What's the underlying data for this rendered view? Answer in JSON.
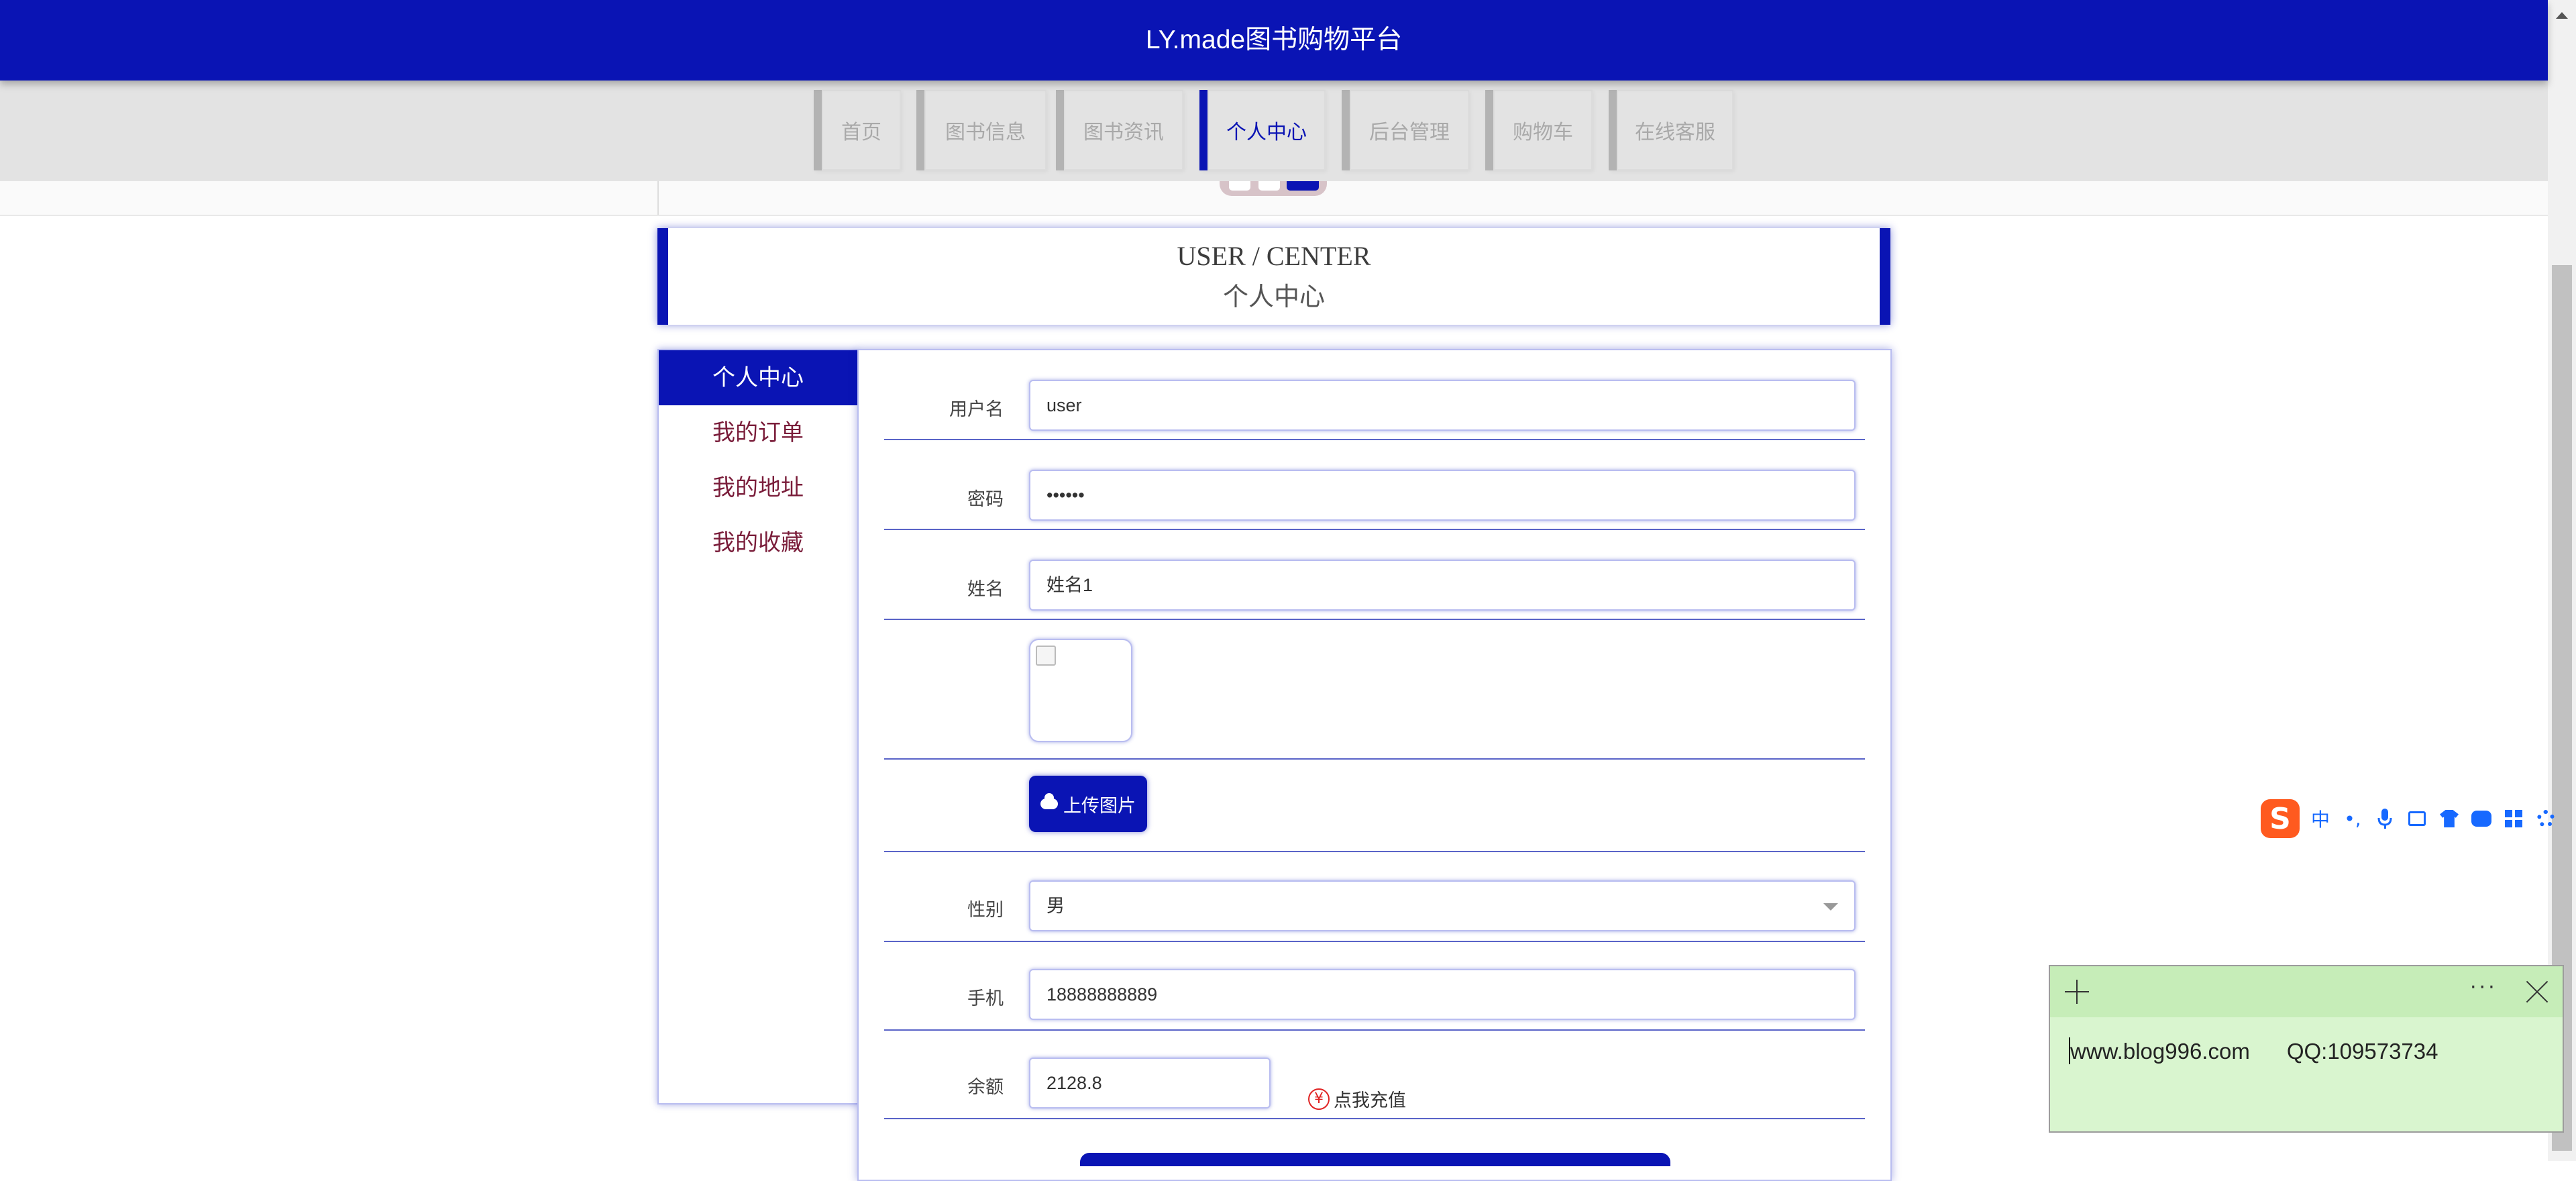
{
  "header": {
    "brand": "LY.made图书购物平台"
  },
  "nav": {
    "tabs": [
      {
        "label": "首页",
        "active": false
      },
      {
        "label": "图书信息",
        "active": false
      },
      {
        "label": "图书资讯",
        "active": false
      },
      {
        "label": "个人中心",
        "active": true
      },
      {
        "label": "后台管理",
        "active": false
      },
      {
        "label": "购物车",
        "active": false
      },
      {
        "label": "在线客服",
        "active": false
      }
    ]
  },
  "title_card": {
    "en": "USER / CENTER",
    "cn": "个人中心"
  },
  "sidemenu": {
    "items": [
      {
        "label": "个人中心",
        "active": true
      },
      {
        "label": "我的订单",
        "active": false
      },
      {
        "label": "我的地址",
        "active": false
      },
      {
        "label": "我的收藏",
        "active": false
      }
    ]
  },
  "form": {
    "username": {
      "label": "用户名",
      "value": "user"
    },
    "password": {
      "label": "密码",
      "value": "••••••"
    },
    "name": {
      "label": "姓名",
      "value": "姓名1"
    },
    "upload_button": "上传图片",
    "gender": {
      "label": "性别",
      "value": "男"
    },
    "phone": {
      "label": "手机",
      "value": "18888888889"
    },
    "balance": {
      "label": "余额",
      "value": "2128.8",
      "recharge_icon": "¥",
      "recharge_label": "点我充值"
    }
  },
  "ime": {
    "logo": "S",
    "mode": "中",
    "punct": "•,",
    "mic": "mic-icon",
    "keyboard": "keyboard-icon",
    "skin": "skin-icon",
    "robot": "robot-icon",
    "apps": "apps-icon",
    "settings": "gear-icon"
  },
  "sticky_note": {
    "text": "www.blog996.com      QQ:109573734",
    "more": "···"
  },
  "colors": {
    "primary": "#0a14b4",
    "nav_bg": "#e3e3e3",
    "accent_text": "#7a1d3a",
    "note_bg": "#d9f5cf",
    "ime_blue": "#1769ff",
    "ime_logo": "#ff5a1f"
  }
}
